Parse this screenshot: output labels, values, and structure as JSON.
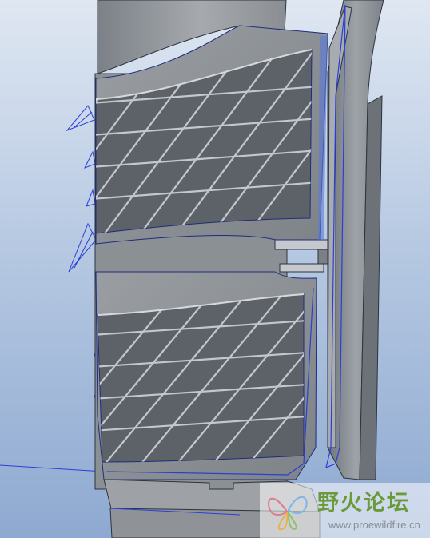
{
  "app": {
    "name": "3D CAD model viewport",
    "background_top": "#dfe7f2",
    "background_bottom": "#8ea9d1"
  },
  "model": {
    "description": "Shaded tire tread segment with diagonal sipe grooves",
    "surface_color": "#8d9196",
    "edge_color": "#1f2d7a",
    "highlight_color": "#3b5cff"
  },
  "watermark": {
    "title": "野火论坛",
    "url": "www.proewildfire.cn",
    "logo_icon": "butterfly-icon",
    "title_color": "#6b9a3a"
  }
}
